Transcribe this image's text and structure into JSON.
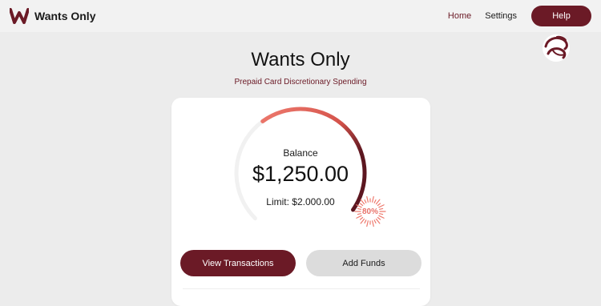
{
  "app": {
    "brand_name": "Wants Only",
    "colors": {
      "accent": "#6b1a26",
      "gauge_light": "#ee7a6e",
      "gauge_dark": "#5c1620",
      "track": "#f1f1f1"
    }
  },
  "nav": {
    "home": "Home",
    "settings": "Settings",
    "help": "Help"
  },
  "header": {
    "title": "Wants Only",
    "subtitle": "Prepaid Card Discretionary Spending"
  },
  "balance": {
    "label": "Balance",
    "amount": "$1,250.00",
    "limit": "Limit: $2.000.00",
    "percent_label": "80%",
    "percent_value": 80
  },
  "actions": {
    "view_transactions": "View Transactions",
    "add_funds": "Add Funds"
  },
  "icons": {
    "brand": "w-logo-icon",
    "badge": "swirl-badge-icon"
  }
}
